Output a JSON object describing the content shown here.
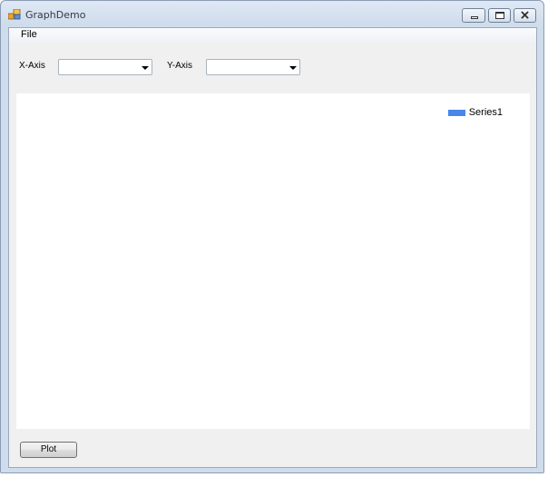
{
  "window": {
    "title": "GraphDemo"
  },
  "menu": {
    "file_label": "File"
  },
  "controls": {
    "x_axis_label": "X-Axis",
    "x_axis_value": "",
    "y_axis_label": "Y-Axis",
    "y_axis_value": "",
    "plot_label": "Plot"
  },
  "chart_data": {
    "type": "bar",
    "series": [
      {
        "name": "Series1",
        "values": []
      }
    ],
    "legend_position": "top-right",
    "colors": {
      "series1": "#4a86e8"
    }
  }
}
